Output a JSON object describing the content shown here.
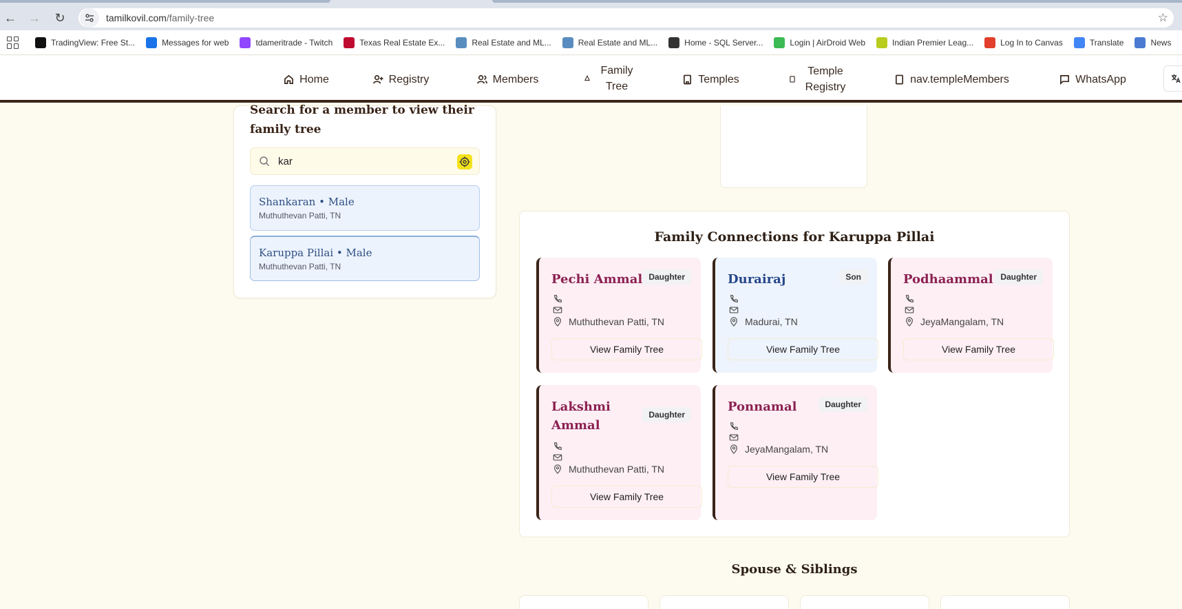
{
  "browser": {
    "url_host": "tamilkovil.com",
    "url_path": "/family-tree",
    "bookmarks": [
      {
        "label": "TradingView: Free St...",
        "icon": "tradingview-icon",
        "color": "#111111"
      },
      {
        "label": "Messages for web",
        "icon": "messages-icon",
        "color": "#1a73e8"
      },
      {
        "label": "tdameritrade - Twitch",
        "icon": "twitch-icon",
        "color": "#9146ff"
      },
      {
        "label": "Texas Real Estate Ex...",
        "icon": "texas-flag-icon",
        "color": "#bf0a30"
      },
      {
        "label": "Real Estate and ML...",
        "icon": "globe-icon",
        "color": "#5a8dbf"
      },
      {
        "label": "Real Estate and ML...",
        "icon": "globe-icon",
        "color": "#5a8dbf"
      },
      {
        "label": "Home - SQL Server...",
        "icon": "chart-icon",
        "color": "#333333"
      },
      {
        "label": "Login | AirDroid Web",
        "icon": "airdroid-icon",
        "color": "#3cba54"
      },
      {
        "label": "Indian Premier Leag...",
        "icon": "ball-icon",
        "color": "#b8cc1e"
      },
      {
        "label": "Log In to Canvas",
        "icon": "canvas-icon",
        "color": "#e13f2b"
      },
      {
        "label": "Translate",
        "icon": "translate-icon",
        "color": "#4285f4"
      },
      {
        "label": "News",
        "icon": "news-icon",
        "color": "#4a7bd0"
      }
    ]
  },
  "nav": {
    "home": "Home",
    "registry": "Registry",
    "members": "Members",
    "family_tree": "Family Tree",
    "temples": "Temples",
    "temple_registry": "Temple Registry",
    "temple_members": "nav.templeMembers",
    "whatsapp": "WhatsApp"
  },
  "search": {
    "title": "Search for a member to view their family tree",
    "query": "kar",
    "results": [
      {
        "name": "Shankaran • Male",
        "place": "Muthuthevan Patti, TN"
      },
      {
        "name": "Karuppa Pillai • Male",
        "place": "Muthuthevan Patti, TN"
      }
    ]
  },
  "connections": {
    "title": "Family Connections for Karuppa Pillai",
    "button_label": "View Family Tree",
    "cards": [
      {
        "name": "Pechi Ammal",
        "relation": "Daughter",
        "location": "Muthuthevan Patti, TN"
      },
      {
        "name": "Durairaj",
        "relation": "Son",
        "location": "Madurai, TN"
      },
      {
        "name": "Podhaammal",
        "relation": "Daughter",
        "location": "JeyaMangalam, TN"
      },
      {
        "name": "Lakshmi Ammal",
        "relation": "Daughter",
        "location": "Muthuthevan Patti, TN"
      },
      {
        "name": "Ponnamal",
        "relation": "Daughter",
        "location": "JeyaMangalam, TN"
      }
    ]
  },
  "spouse_siblings": {
    "title": "Spouse & Siblings"
  }
}
